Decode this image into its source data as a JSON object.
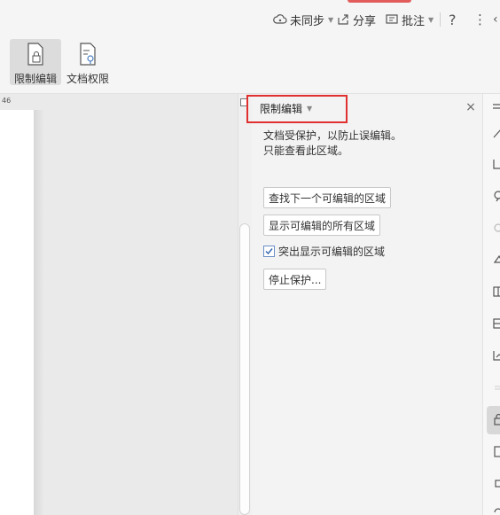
{
  "toolbar": {
    "sync_label": "未同步",
    "share_label": "分享",
    "comment_label": "批注",
    "help_label": "?",
    "more_label": "⋮"
  },
  "ribbon": {
    "restrict_edit_label": "限制编辑",
    "doc_permission_label": "文档权限"
  },
  "ruler": {
    "mark": "46"
  },
  "panel": {
    "title": "限制编辑",
    "close_label": "×",
    "desc_line1": "文档受保护，以防止误编辑。",
    "desc_line2": "只能查看此区域。",
    "find_next_label": "查找下一个可编辑的区域",
    "show_all_label": "显示可编辑的所有区域",
    "highlight_label": "突出显示可编辑的区域",
    "highlight_checked": true,
    "stop_protect_label": "停止保护..."
  },
  "sidebar": {
    "icons": [
      "format-icon",
      "select-icon",
      "location-icon",
      "clock-icon",
      "shapes-icon",
      "layout-icon",
      "grid-icon",
      "chart-icon",
      "divider",
      "lock-icon",
      "page-icon",
      "square-icon"
    ]
  },
  "colors": {
    "highlight_border": "#e03030",
    "top_accent": "#e25c5c",
    "checkbox": "#6a8fc7"
  }
}
